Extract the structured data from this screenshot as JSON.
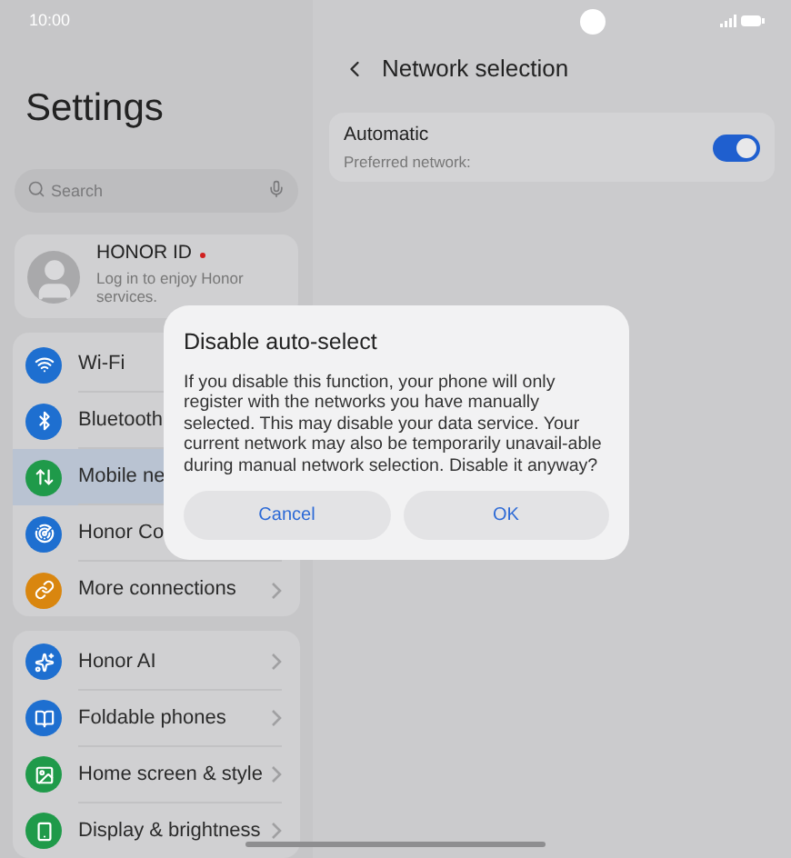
{
  "status_bar": {
    "time": "10:00"
  },
  "sidebar": {
    "title": "Settings",
    "search": {
      "placeholder": "Search"
    },
    "account": {
      "name": "HONOR ID",
      "subtitle": "Log in to enjoy Honor services.",
      "notification_dot": true
    },
    "groups": [
      {
        "items": [
          {
            "label": "Wi-Fi",
            "color": "#1e6fd0",
            "selected": false,
            "chevron": false
          },
          {
            "label": "Bluetooth",
            "color": "#1e6fd0",
            "selected": false,
            "chevron": false
          },
          {
            "label": "Mobile ne",
            "color": "#1f9a4a",
            "selected": true,
            "chevron": false
          },
          {
            "label": "Honor Co",
            "color": "#1e6fd0",
            "selected": false,
            "chevron": false
          },
          {
            "label": "More connections",
            "color": "#d9860f",
            "selected": false,
            "chevron": true
          }
        ]
      },
      {
        "items": [
          {
            "label": "Honor AI",
            "color": "#1e6fd0",
            "selected": false,
            "chevron": true
          },
          {
            "label": "Foldable phones",
            "color": "#1e6fd0",
            "selected": false,
            "chevron": true
          },
          {
            "label": "Home screen & style",
            "color": "#1f9a4a",
            "selected": false,
            "chevron": true
          },
          {
            "label": "Display & brightness",
            "color": "#1f9a4a",
            "selected": false,
            "chevron": true
          }
        ]
      }
    ]
  },
  "detail": {
    "title": "Network selection",
    "setting": {
      "label": "Automatic",
      "subtitle": "Preferred network:",
      "on": true
    }
  },
  "dialog": {
    "title": "Disable auto-select",
    "message": "If you disable this function, your phone will only register with the networks you have manually selected. This may disable your data service. Your current network may also be temporarily unavail-able during manual network selection. Disable it anyway?",
    "buttons": [
      "Cancel",
      "OK"
    ]
  }
}
